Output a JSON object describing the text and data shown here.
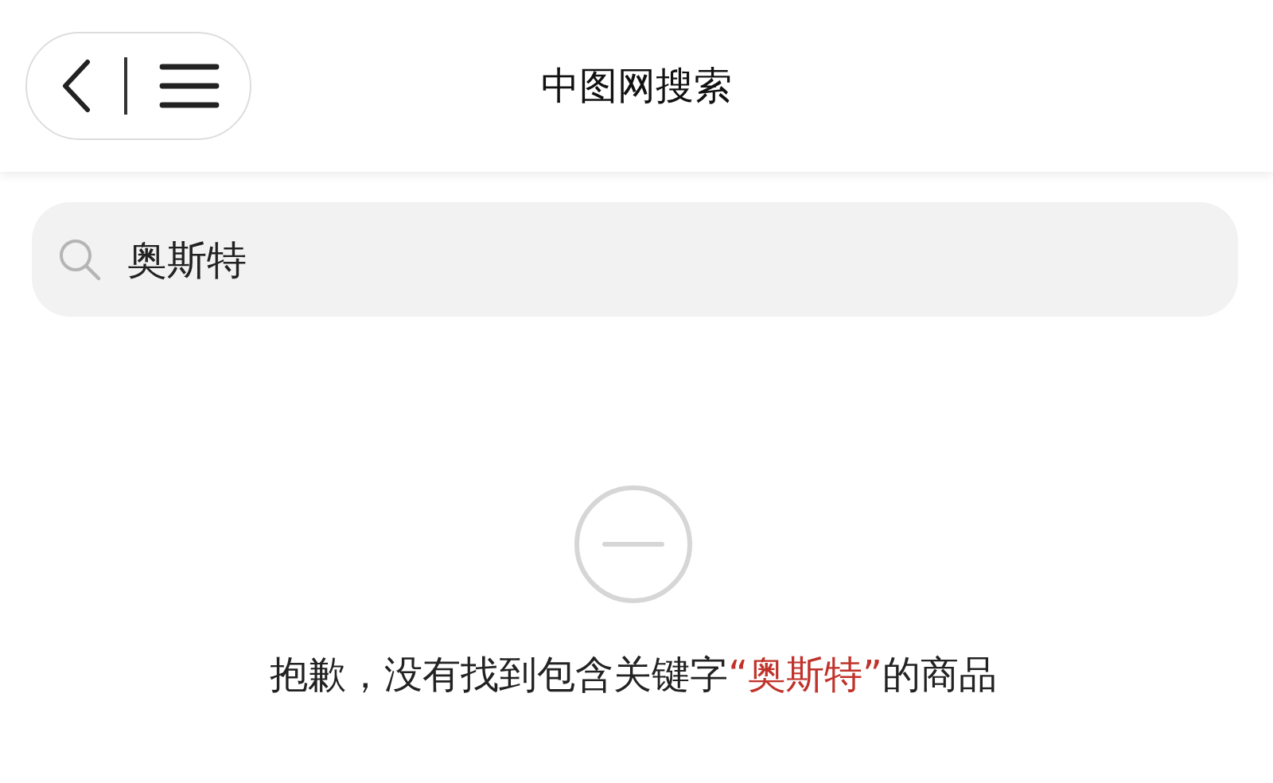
{
  "header": {
    "title": "中图网搜索"
  },
  "search": {
    "value": "奥斯特"
  },
  "empty_state": {
    "message_before": "抱歉，没有找到包含关键字",
    "keyword": "“奥斯特”",
    "message_after": "的商品"
  }
}
